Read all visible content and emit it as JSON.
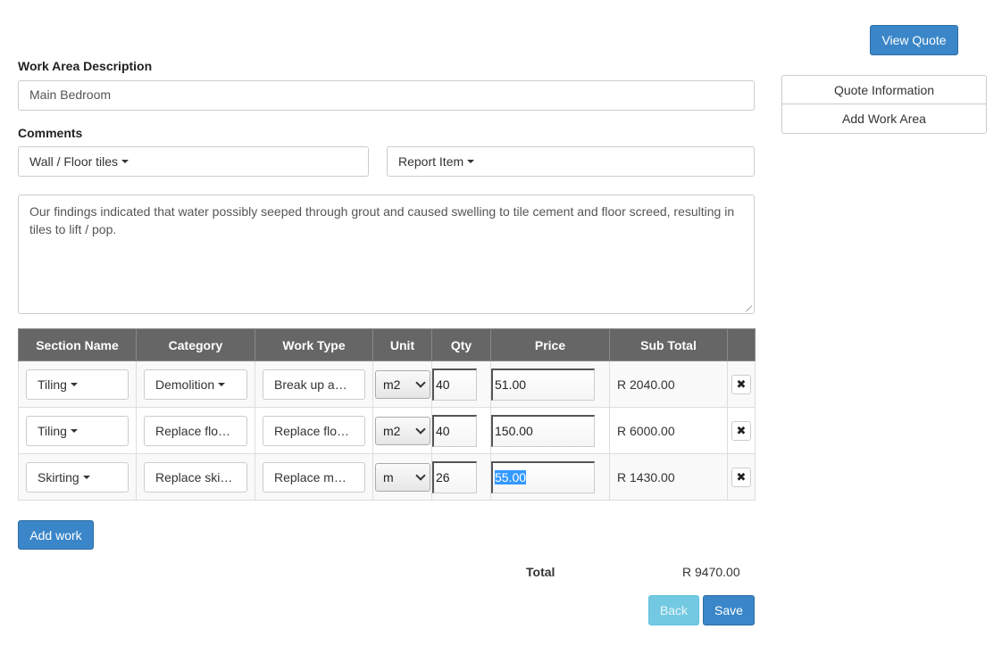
{
  "header": {
    "view_quote_label": "View Quote"
  },
  "form": {
    "work_area_label": "Work Area Description",
    "work_area_value": "Main Bedroom",
    "comments_label": "Comments",
    "comment_category": "Wall / Floor tiles",
    "comment_type": "Report Item",
    "comment_text": "Our findings indicated that water possibly seeped through grout and caused swelling to tile cement and floor screed, resulting in tiles to lift / pop."
  },
  "table": {
    "headers": [
      "Section Name",
      "Category",
      "Work Type",
      "Unit",
      "Qty",
      "Price",
      "Sub Total",
      ""
    ],
    "rows": [
      {
        "section": "Tiling",
        "category": "Demolition",
        "work_type": "Break up a…",
        "unit": "m2",
        "qty": "40",
        "price": "51.00",
        "subtotal": "R 2040.00",
        "delete": "✖"
      },
      {
        "section": "Tiling",
        "category": "Replace flo…",
        "work_type": "Replace flo…",
        "unit": "m2",
        "qty": "40",
        "price": "150.00",
        "subtotal": "R 6000.00",
        "delete": "✖"
      },
      {
        "section": "Skirting",
        "category": "Replace ski…",
        "work_type": "Replace m…",
        "unit": "m",
        "qty": "26",
        "price": "55.00",
        "subtotal": "R 1430.00",
        "delete": "✖"
      }
    ]
  },
  "actions": {
    "add_work_label": "Add work",
    "total_label": "Total",
    "total_value": "R 9470.00",
    "back_label": "Back",
    "save_label": "Save"
  },
  "sidebar": {
    "items": [
      {
        "label": "Quote Information"
      },
      {
        "label": "Add Work Area"
      }
    ]
  },
  "colors": {
    "primary": "#3a86c8",
    "info": "#5bc0de",
    "table_header": "#666666",
    "selection": "#3399ff"
  }
}
